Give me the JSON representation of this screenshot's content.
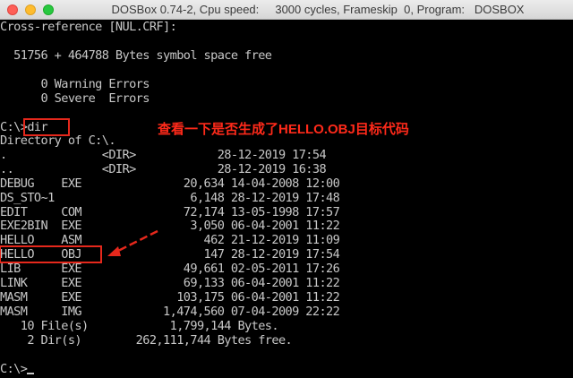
{
  "window": {
    "title": "DOSBox 0.74-2, Cpu speed:     3000 cycles, Frameskip  0, Program:   DOSBOX"
  },
  "terminal": {
    "lines": [
      "Cross-reference [NUL.CRF]:",
      "",
      "",
      "  51756 + 464788 Bytes symbol space free",
      "",
      "      0 Warning Errors",
      "      0 Severe  Errors",
      "",
      "C:\\>dir",
      "Directory of C:\\.",
      ".              <DIR>            28-12-2019 17:54",
      "..             <DIR>            28-12-2019 16:38",
      "DEBUG    EXE               20,634 14-04-2008 12:00",
      "DS_STO~1                    6,148 28-12-2019 17:48",
      "EDIT     COM               72,174 13-05-1998 17:57",
      "EXE2BIN  EXE                3,050 06-04-2001 11:22",
      "HELLO    ASM                  462 21-12-2019 11:09",
      "HELLO    OBJ                  147 28-12-2019 17:54",
      "LIB      EXE               49,661 02-05-2011 17:26",
      "LINK     EXE               69,133 06-04-2001 11:22",
      "MASM     EXE              103,175 06-04-2001 11:22",
      "MASM     IMG            1,474,560 07-04-2009 22:22",
      "   10 File(s)            1,799,144 Bytes.",
      "    2 Dir(s)        262,111,744 Bytes free.",
      "",
      "C:\\>"
    ]
  },
  "annotation": {
    "note": "查看一下是否生成了HELLO.OBJ目标代码",
    "color": "#e5281c"
  }
}
